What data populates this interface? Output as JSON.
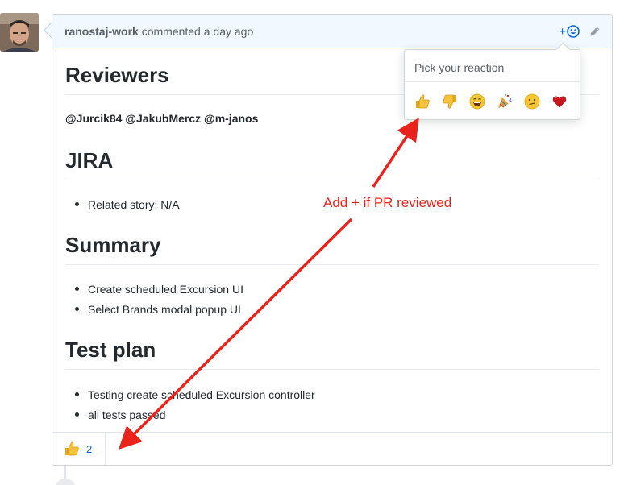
{
  "comment": {
    "author": "ranostaj-work",
    "action": "commented",
    "time": "a day ago",
    "add_reaction_plus": "+"
  },
  "sections": [
    {
      "heading": "Reviewers",
      "mentions": "@Jurcik84 @JakubMercz @m-janos"
    },
    {
      "heading": "JIRA",
      "items": [
        "Related story: N/A"
      ]
    },
    {
      "heading": "Summary",
      "items": [
        "Create scheduled Excursion UI",
        "Select Brands modal popup UI"
      ]
    },
    {
      "heading": "Test plan",
      "items": [
        "Testing create scheduled Excursion controller",
        "all tests passed"
      ]
    }
  ],
  "reactions": {
    "thumbs_up_count": "2",
    "popover_title": "Pick your reaction",
    "options": [
      "thumbs-up",
      "thumbs-down",
      "laugh",
      "hooray",
      "confused",
      "heart"
    ]
  },
  "annotation": {
    "text": "Add + if PR reviewed",
    "color": "#e8231b"
  },
  "colors": {
    "link": "#0366d6",
    "header_bg": "#f1f8ff",
    "border": "#d1d5da"
  }
}
